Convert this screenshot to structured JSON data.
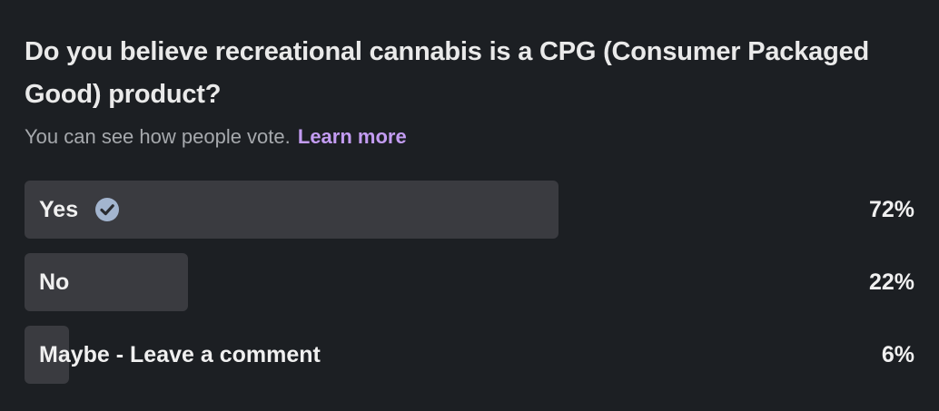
{
  "poll": {
    "question": "Do you believe recreational cannabis is a CPG (Consumer Packaged Good) product?",
    "subtitle": "You can see how people vote.",
    "learn_more": "Learn more",
    "options": [
      {
        "label": "Yes",
        "percent_text": "72%",
        "share": 0.72,
        "selected": true
      },
      {
        "label": "No",
        "percent_text": "22%",
        "share": 0.22,
        "selected": false
      },
      {
        "label": "Maybe - Leave a comment",
        "percent_text": "6%",
        "share": 0.06,
        "selected": false
      }
    ],
    "icons": {
      "selected": "check-circle-icon"
    },
    "colors": {
      "background": "#1c1f23",
      "bar": "#3a3b40",
      "link": "#c39cf2",
      "check": "#a3b5cf"
    }
  }
}
